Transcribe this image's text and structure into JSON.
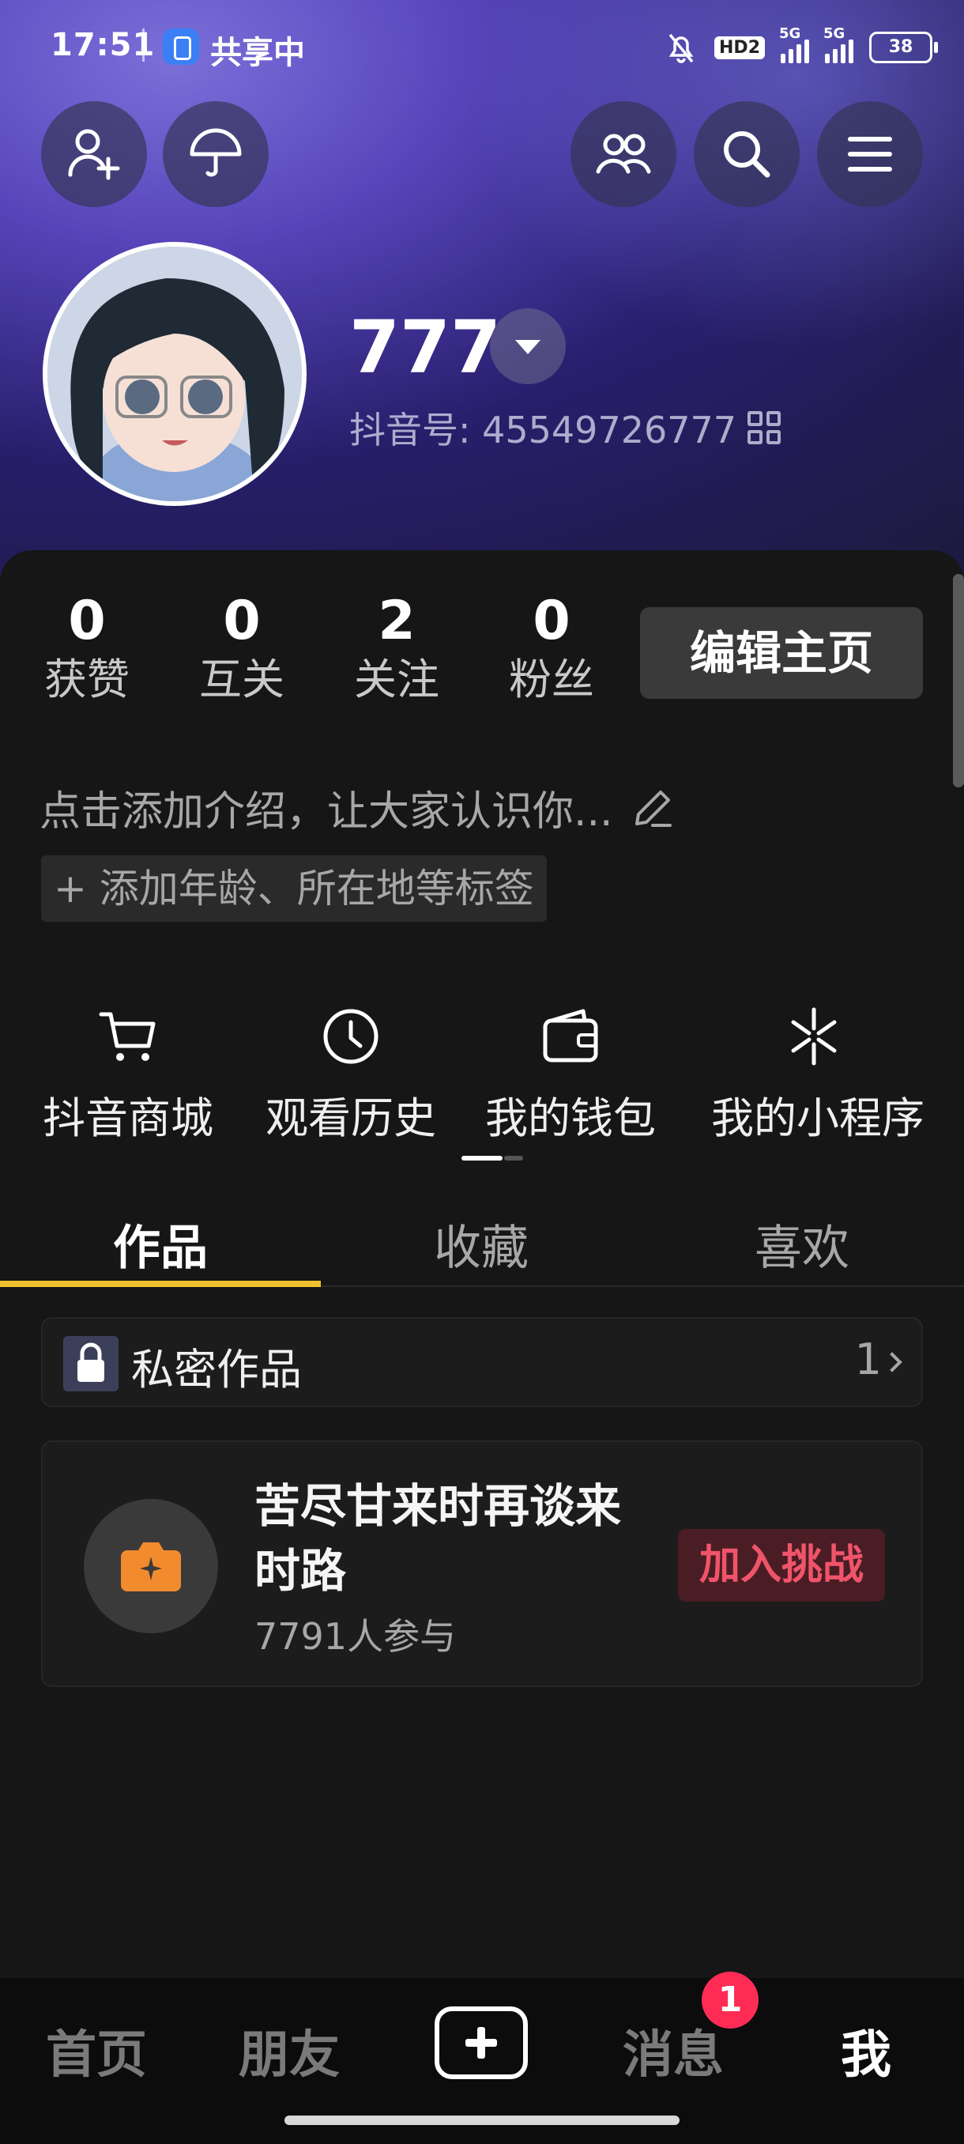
{
  "status_bar": {
    "time": "17:51",
    "share": "共享中",
    "hd": "HD2",
    "signal1": "5G",
    "signal2": "5G",
    "battery": "38"
  },
  "profile": {
    "name": "777",
    "douyin_id": "抖音号: 45549726777"
  },
  "stats": [
    {
      "num": "0",
      "label": "获赞"
    },
    {
      "num": "0",
      "label": "互关"
    },
    {
      "num": "2",
      "label": "关注"
    },
    {
      "num": "0",
      "label": "粉丝"
    }
  ],
  "edit_button": "编辑主页",
  "bio_placeholder": "点击添加介绍，让大家认识你...",
  "tags_button": "+ 添加年龄、所在地等标签",
  "tools": [
    {
      "label": "抖音商城",
      "icon": "cart-icon"
    },
    {
      "label": "观看历史",
      "icon": "clock-icon"
    },
    {
      "label": "我的钱包",
      "icon": "wallet-icon"
    },
    {
      "label": "我的小程序",
      "icon": "sparkle-icon"
    }
  ],
  "tabs": [
    "作品",
    "收藏",
    "喜欢"
  ],
  "private_works": {
    "label": "私密作品",
    "count": "1"
  },
  "challenge": {
    "title": "苦尽甘来时再谈来时路",
    "participants": "7791人参与",
    "join": "加入挑战"
  },
  "bottom_nav": {
    "home": "首页",
    "friends": "朋友",
    "messages": "消息",
    "me": "我",
    "badge": "1"
  },
  "colors": {
    "accent": "#f0c22e",
    "badge": "#fe2c55",
    "join_text": "#f0546a"
  }
}
